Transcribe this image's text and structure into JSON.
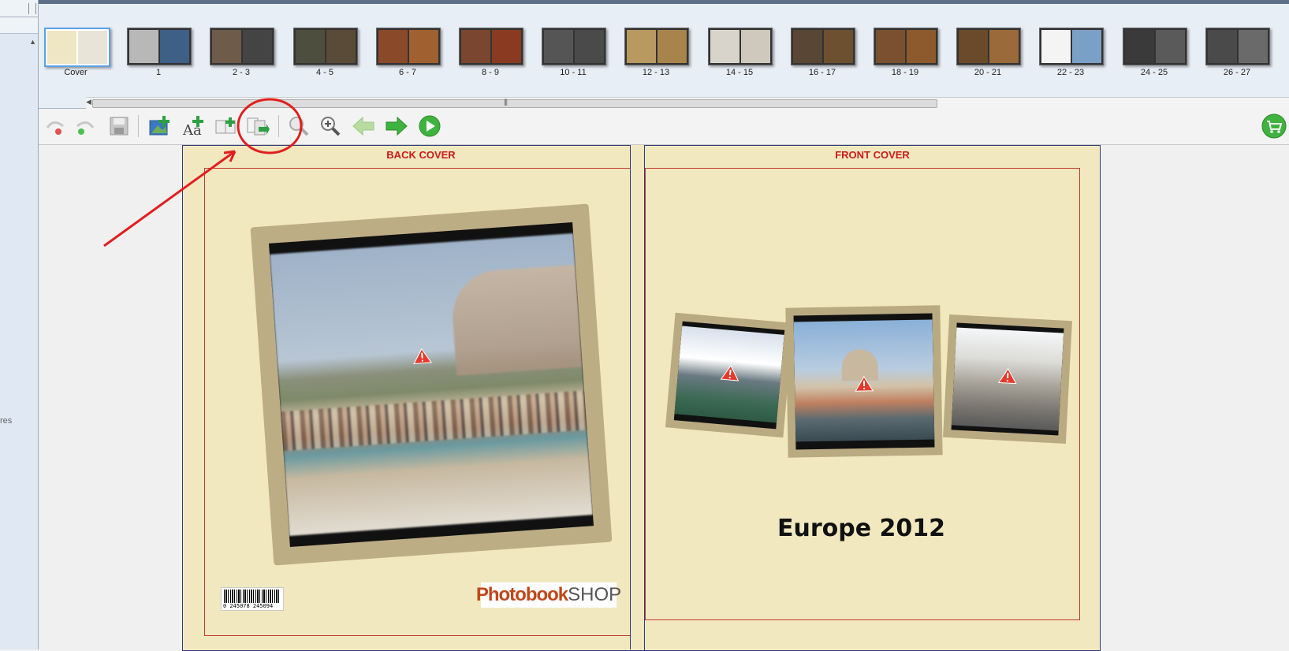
{
  "left_panel": {
    "partial_label": "res"
  },
  "thumbnails": [
    {
      "label": "Cover",
      "left": "#efe6c4",
      "right": "#e9e4d8",
      "selected": true
    },
    {
      "label": "1",
      "left": "#b8b8b8",
      "right": "#3e5f86"
    },
    {
      "label": "2 - 3",
      "left": "#6e5b4a",
      "right": "#444"
    },
    {
      "label": "4 - 5",
      "left": "#4e4e3e",
      "right": "#5a4a38"
    },
    {
      "label": "6 - 7",
      "left": "#8a4a2a",
      "right": "#a06030"
    },
    {
      "label": "8 - 9",
      "left": "#7a4630",
      "right": "#8a3a20"
    },
    {
      "label": "10 - 11",
      "left": "#555",
      "right": "#4a4a4a"
    },
    {
      "label": "12 - 13",
      "left": "#b89a60",
      "right": "#a8844c"
    },
    {
      "label": "14 - 15",
      "left": "#d8d4cc",
      "right": "#cfc8bc"
    },
    {
      "label": "16 - 17",
      "left": "#5a4634",
      "right": "#6c5030"
    },
    {
      "label": "18 - 19",
      "left": "#7a5030",
      "right": "#8c5a2c"
    },
    {
      "label": "20 - 21",
      "left": "#6a4a2a",
      "right": "#9a6a3a"
    },
    {
      "label": "22 - 23",
      "left": "#f4f4f4",
      "right": "#7aa0c8"
    },
    {
      "label": "24 - 25",
      "left": "#3a3a3a",
      "right": "#5a5a5a"
    },
    {
      "label": "26 - 27",
      "left": "#4a4a4a",
      "right": "#6a6a6a"
    }
  ],
  "toolbar": {
    "undo": "undo-icon",
    "redo": "redo-icon",
    "save": "save-icon",
    "add_photo": "add-photo-icon",
    "add_text": "add-text-icon",
    "add_page": "add-page-icon",
    "swap_pages": "swap-pages-icon",
    "zoom_out": "zoom-out-icon",
    "zoom_in": "zoom-in-icon",
    "prev": "arrow-left-icon",
    "next": "arrow-right-icon",
    "play": "play-icon",
    "cart": "cart-icon"
  },
  "pages": {
    "back_title": "BACK COVER",
    "front_title": "FRONT COVER",
    "front_caption": "Europe 2012",
    "barcode_number": "0 245078 245094",
    "logo_a": "Photobook",
    "logo_b": "SHOP"
  },
  "colors": {
    "accent_red": "#cc1a1a",
    "page_bg": "#f1e8c0",
    "frame": "#b9aa82"
  }
}
